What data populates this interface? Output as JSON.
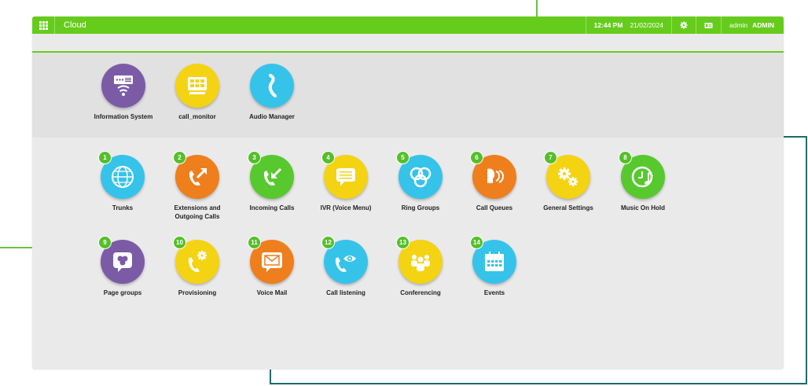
{
  "topbar": {
    "title": "Cloud",
    "time": "12:44 PM",
    "date": "21/02/2024",
    "user": "admin",
    "role": "ADMIN",
    "icons": [
      "apps-grid-icon",
      "gear-icon",
      "id-card-icon"
    ]
  },
  "colors": {
    "brand_green": "#66cc1c",
    "purple": "#7b5ba6",
    "yellow": "#f4d313",
    "blue": "#36c3ea",
    "orange": "#ee7f1c",
    "green": "#57c92e"
  },
  "system_apps": [
    {
      "label": "Information System",
      "icon": "server-icon",
      "color": "purple"
    },
    {
      "label": "call_monitor",
      "icon": "monitor-icon",
      "color": "yellow"
    },
    {
      "label": "Audio Manager",
      "icon": "audio-icon",
      "color": "blue"
    }
  ],
  "modules": [
    {
      "number": "1",
      "label": "Trunks",
      "icon": "globe-icon",
      "color": "blue"
    },
    {
      "number": "2",
      "label": "Extensions and Outgoing Calls",
      "icon": "outgoing-call-icon",
      "color": "orange"
    },
    {
      "number": "3",
      "label": "Incoming Calls",
      "icon": "incoming-call-icon",
      "color": "green"
    },
    {
      "number": "4",
      "label": "IVR (Voice Menu)",
      "icon": "chat-menu-icon",
      "color": "yellow"
    },
    {
      "number": "5",
      "label": "Ring Groups",
      "icon": "ring-groups-icon",
      "color": "blue"
    },
    {
      "number": "6",
      "label": "Call Queues",
      "icon": "queue-heads-icon",
      "color": "orange"
    },
    {
      "number": "7",
      "label": "General Settings",
      "icon": "gears-icon",
      "color": "yellow"
    },
    {
      "number": "8",
      "label": "Music On Hold",
      "icon": "music-clock-icon",
      "color": "green"
    },
    {
      "number": "9",
      "label": "Page groups",
      "icon": "page-groups-icon",
      "color": "purple"
    },
    {
      "number": "10",
      "label": "Provisioning",
      "icon": "phone-gear-icon",
      "color": "yellow"
    },
    {
      "number": "11",
      "label": "Voice Mail",
      "icon": "envelope-icon",
      "color": "orange"
    },
    {
      "number": "12",
      "label": "Call listening",
      "icon": "phone-eye-icon",
      "color": "blue"
    },
    {
      "number": "13",
      "label": "Conferencing",
      "icon": "people-icon",
      "color": "yellow"
    },
    {
      "number": "14",
      "label": "Events",
      "icon": "calendar-icon",
      "color": "blue"
    }
  ]
}
